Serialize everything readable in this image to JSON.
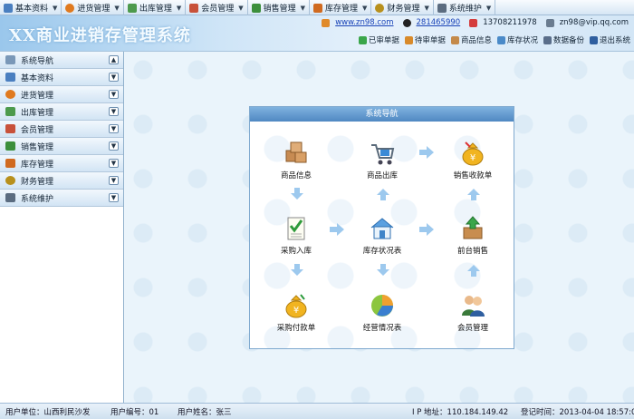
{
  "menu": [
    {
      "label": "基本资料",
      "icon": "book-icon",
      "color": "#4a7fc0"
    },
    {
      "label": "进货管理",
      "icon": "globe-icon",
      "color": "#e07a1f"
    },
    {
      "label": "出库管理",
      "icon": "sheet-icon",
      "color": "#4d9a4d"
    },
    {
      "label": "会员管理",
      "icon": "members-icon",
      "color": "#c8513a"
    },
    {
      "label": "销售管理",
      "icon": "chart-icon",
      "color": "#3c8f3c"
    },
    {
      "label": "库存管理",
      "icon": "house-icon",
      "color": "#d06a20"
    },
    {
      "label": "财务管理",
      "icon": "coins-icon",
      "color": "#b8901c"
    },
    {
      "label": "系统维护",
      "icon": "monitor-icon",
      "color": "#5b6c80"
    }
  ],
  "banner": {
    "title": "XX商业进销存管理系统",
    "website": "www.zn98.com",
    "qq": "281465990",
    "phone": "13708211978",
    "email": "zn98@vip.qq.com"
  },
  "quick": [
    "已审单据",
    "待审单据",
    "商品信息",
    "库存状况",
    "数据备份",
    "退出系统"
  ],
  "sidebar": [
    {
      "label": "系统导航",
      "icon": "nav-icon"
    },
    {
      "label": "基本资料",
      "icon": "book-icon"
    },
    {
      "label": "进货管理",
      "icon": "globe-icon"
    },
    {
      "label": "出库管理",
      "icon": "sheet-icon"
    },
    {
      "label": "会员管理",
      "icon": "members-icon"
    },
    {
      "label": "销售管理",
      "icon": "chart-icon"
    },
    {
      "label": "库存管理",
      "icon": "house-icon"
    },
    {
      "label": "财务管理",
      "icon": "coins-icon"
    },
    {
      "label": "系统维护",
      "icon": "monitor-icon"
    }
  ],
  "panel": {
    "title": "系统导航",
    "nodes": {
      "goods": "商品信息",
      "outbound": "商品出库",
      "receipt": "销售收款单",
      "purchase": "采购入库",
      "stock": "库存状况表",
      "frontsale": "前台销售",
      "payment": "采购付款单",
      "business": "经营情况表",
      "members": "会员管理"
    }
  },
  "status": {
    "unit": "用户单位：山西利民沙发",
    "userid": "用户编号：01",
    "username": "用户姓名：张三",
    "ip": "I P 地址：110.184.149.42",
    "login": "登记时间：2013-04-04 18:57:07"
  }
}
